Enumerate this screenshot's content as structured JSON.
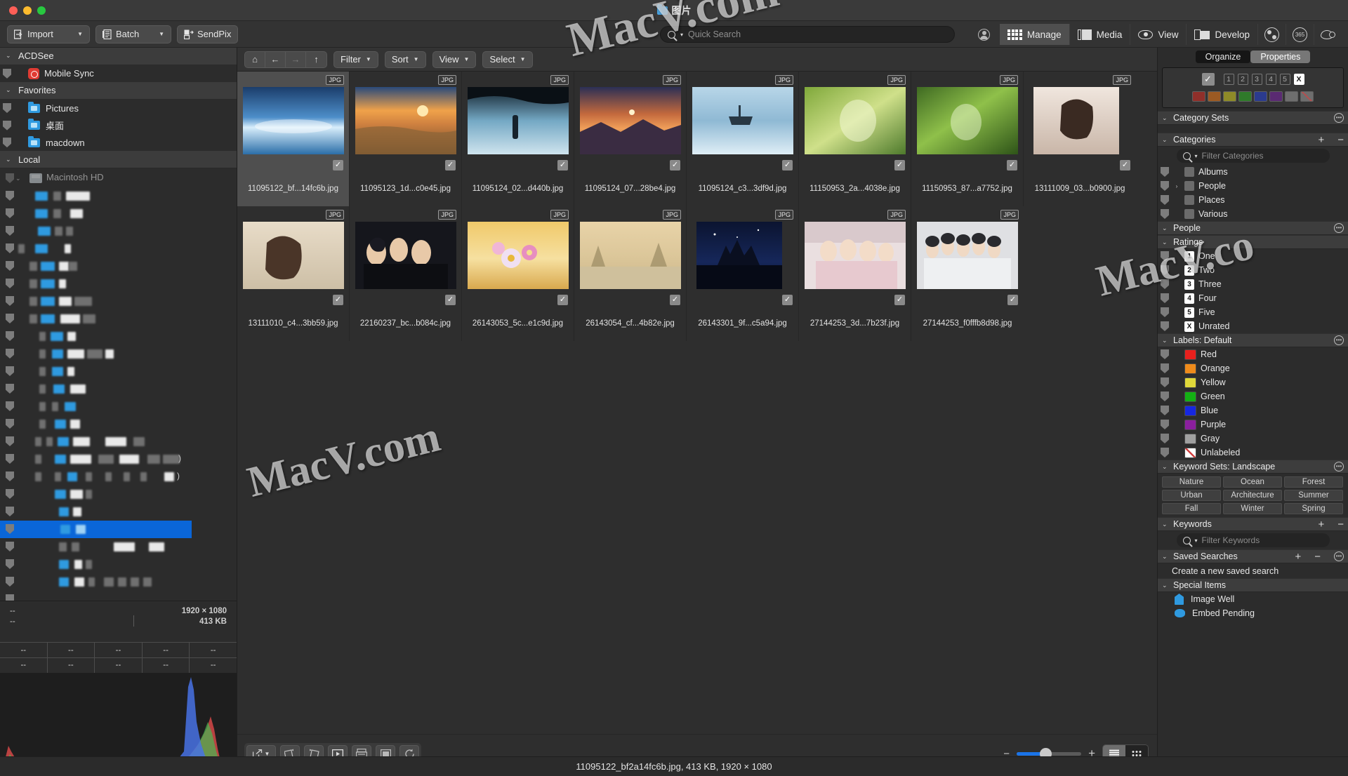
{
  "window": {
    "title": "图片"
  },
  "toolbar": {
    "import": "Import",
    "batch": "Batch",
    "sendpix": "SendPix",
    "search_placeholder": "Quick Search",
    "modes": [
      {
        "label": "Manage",
        "icon": "grid-icon"
      },
      {
        "label": "Media",
        "icon": "media-icon"
      },
      {
        "label": "View",
        "icon": "eye-icon"
      },
      {
        "label": "Develop",
        "icon": "develop-icon"
      }
    ],
    "extra_icons": [
      "account-icon",
      "flowers-icon",
      "365-icon",
      "swirl-icon"
    ],
    "badge_365": "365"
  },
  "sidebar": {
    "groups": [
      {
        "label": "ACDSee",
        "items": [
          {
            "label": "Mobile Sync",
            "icon": "mobile-sync-icon"
          }
        ]
      },
      {
        "label": "Favorites",
        "items": [
          {
            "label": "Pictures",
            "icon": "folder-icon"
          },
          {
            "label": "桌面",
            "icon": "folder-icon"
          },
          {
            "label": "macdown",
            "icon": "folder-icon"
          }
        ]
      },
      {
        "label": "Local",
        "items": [
          {
            "label": "Macintosh HD",
            "icon": "harddisk-icon"
          }
        ]
      }
    ]
  },
  "metadata": {
    "left_top": "--",
    "left_bottom": "--",
    "dimensions": "1920 × 1080",
    "filesize": "413 KB",
    "row1": [
      "--",
      "--",
      "--",
      "--",
      "--"
    ],
    "row2": [
      "--",
      "--",
      "--",
      "--",
      "--"
    ]
  },
  "content_toolbar": {
    "nav": [
      "home-icon",
      "back-icon",
      "forward-icon",
      "up-icon"
    ],
    "buttons": [
      "Filter",
      "Sort",
      "View",
      "Select"
    ]
  },
  "thumbnails": [
    {
      "filename": "11095122_bf...14fc6b.jpg",
      "badge": "JPG",
      "checked": true,
      "selected": true
    },
    {
      "filename": "11095123_1d...c0e45.jpg",
      "badge": "JPG",
      "checked": true,
      "selected": false
    },
    {
      "filename": "11095124_02...d440b.jpg",
      "badge": "JPG",
      "checked": true,
      "selected": false
    },
    {
      "filename": "11095124_07...28be4.jpg",
      "badge": "JPG",
      "checked": true,
      "selected": false
    },
    {
      "filename": "11095124_c3...3df9d.jpg",
      "badge": "JPG",
      "checked": true,
      "selected": false
    },
    {
      "filename": "11150953_2a...4038e.jpg",
      "badge": "JPG",
      "checked": true,
      "selected": false
    },
    {
      "filename": "11150953_87...a7752.jpg",
      "badge": "JPG",
      "checked": true,
      "selected": false
    },
    {
      "filename": "13111009_03...b0900.jpg",
      "badge": "JPG",
      "checked": true,
      "selected": false
    },
    {
      "filename": "13111010_c4...3bb59.jpg",
      "badge": "JPG",
      "checked": true,
      "selected": false
    },
    {
      "filename": "22160237_bc...b084c.jpg",
      "badge": "JPG",
      "checked": true,
      "selected": false
    },
    {
      "filename": "26143053_5c...e1c9d.jpg",
      "badge": "JPG",
      "checked": true,
      "selected": false
    },
    {
      "filename": "26143054_cf...4b82e.jpg",
      "badge": "JPG",
      "checked": true,
      "selected": false
    },
    {
      "filename": "26143301_9f...c5a94.jpg",
      "badge": "JPG",
      "checked": true,
      "selected": false
    },
    {
      "filename": "27144253_3d...7b23f.jpg",
      "badge": "JPG",
      "checked": true,
      "selected": false
    },
    {
      "filename": "27144253_f0fffb8d98.jpg",
      "badge": "JPG",
      "checked": true,
      "selected": false
    }
  ],
  "bottom_bar": {
    "icons": [
      "export-icon",
      "rotate-left-icon",
      "rotate-right-icon",
      "slideshow-icon",
      "archive-icon",
      "duplicate-icon",
      "refresh-icon"
    ],
    "zoom_minus": "−",
    "zoom_plus": "+",
    "view_list_icon": "list-view-icon",
    "view_grid_icon": "grid-view-icon"
  },
  "right_panel": {
    "tabs": [
      {
        "label": "Organize",
        "active": false
      },
      {
        "label": "Properties",
        "active": true
      }
    ],
    "rating_buttons": [
      "1",
      "2",
      "3",
      "4",
      "5",
      "X"
    ],
    "color_swatches": [
      "#8f2f2a",
      "#9b5a23",
      "#8e8a28",
      "#2f7a2a",
      "#2b3b8e",
      "#5a2a72",
      "#6e6e6e",
      "#6e6e6e"
    ],
    "sections": {
      "category_sets": "Category Sets",
      "categories": "Categories",
      "categories_filter_placeholder": "Filter Categories",
      "people": "People",
      "ratings": "Ratings",
      "labels": "Labels: Default",
      "keyword_sets": "Keyword Sets: Landscape",
      "keywords": "Keywords",
      "keywords_filter_placeholder": "Filter Keywords",
      "saved_searches": "Saved Searches",
      "special_items": "Special Items"
    },
    "categories": [
      {
        "label": "Albums",
        "expandable": false
      },
      {
        "label": "People",
        "expandable": true
      },
      {
        "label": "Places",
        "expandable": false
      },
      {
        "label": "Various",
        "expandable": false
      }
    ],
    "ratings": [
      {
        "label": "One",
        "key": "1"
      },
      {
        "label": "Two",
        "key": "2"
      },
      {
        "label": "Three",
        "key": "3"
      },
      {
        "label": "Four",
        "key": "4"
      },
      {
        "label": "Five",
        "key": "5"
      },
      {
        "label": "Unrated",
        "key": "X"
      }
    ],
    "labels": [
      {
        "label": "Red",
        "color": "#e8201d"
      },
      {
        "label": "Orange",
        "color": "#ef8b1b"
      },
      {
        "label": "Yellow",
        "color": "#e0d83a"
      },
      {
        "label": "Green",
        "color": "#13b013"
      },
      {
        "label": "Blue",
        "color": "#1627e0"
      },
      {
        "label": "Purple",
        "color": "#8b1f9e"
      },
      {
        "label": "Gray",
        "color": "#a0a0a0"
      },
      {
        "label": "Unlabeled",
        "color": "#ffffff"
      }
    ],
    "keyword_sets": [
      "Nature",
      "Ocean",
      "Forest",
      "Urban",
      "Architecture",
      "Summer",
      "Fall",
      "Winter",
      "Spring"
    ],
    "saved_search_create": "Create a new saved search",
    "special_items": [
      {
        "label": "Image Well",
        "icon": "well-icon"
      },
      {
        "label": "Embed Pending",
        "icon": "embed-icon"
      }
    ]
  },
  "statusbar": {
    "text": "11095122_bf2a14fc6b.jpg, 413 KB, 1920 × 1080"
  },
  "watermarks": [
    "MacV.com",
    "MacV.co",
    "MacV.com"
  ]
}
